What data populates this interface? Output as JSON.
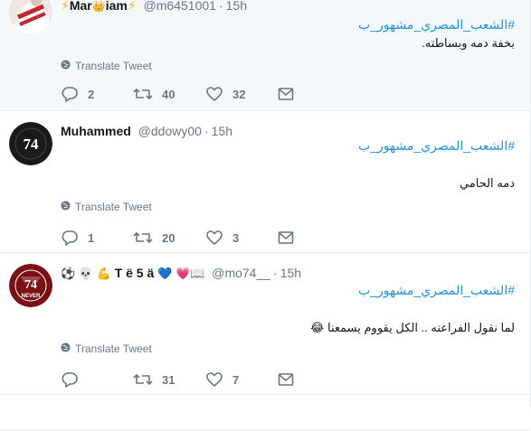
{
  "tweets": [
    {
      "name_prefix": "⚡",
      "name": "Mar",
      "name_crown": "👑",
      "name_rest": "iam",
      "name_suffix": "⚡",
      "handle": "@m6451001",
      "time": "15h",
      "hashtag": "#الشعب_المصري_مشهور_ب",
      "text": "بخفة دمه وبساطته.",
      "translate": "Translate Tweet",
      "replies": "2",
      "retweets": "40",
      "likes": "32"
    },
    {
      "name": "Muhammed",
      "handle": "@ddowy00",
      "time": "15h",
      "avatar_text": "74",
      "hashtag": "#الشعب_المصري_مشهور_ب",
      "text": "دمه الحامي",
      "translate": "Translate Tweet",
      "replies": "1",
      "retweets": "20",
      "likes": "3"
    },
    {
      "name_emojis": "⚽ 💀 💪",
      "name": "T ë 5 ä",
      "name_tail_emojis": "💙 💗📖",
      "handle": "@mo74__",
      "time": "15h",
      "avatar_text": "74",
      "avatar_sub": "NEVER",
      "hashtag": "#الشعب_المصري_مشهور_ب",
      "text": "لما نقول الفراعنه .. الكل يقووم يسمعنا",
      "text_emoji": "😂",
      "translate": "Translate Tweet",
      "replies": "",
      "retweets": "31",
      "likes": "7"
    }
  ],
  "colors": {
    "link": "#1b95e0",
    "muted": "#657786",
    "highlight_bg": "#f5f8fa"
  }
}
